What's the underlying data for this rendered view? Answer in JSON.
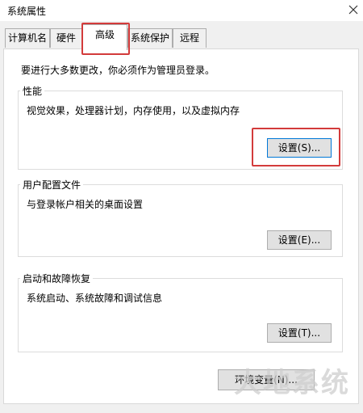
{
  "window": {
    "title": "系统属性",
    "close_icon": "close-icon"
  },
  "tabs": [
    {
      "label": "计算机名",
      "active": false
    },
    {
      "label": "硬件",
      "active": false
    },
    {
      "label": "高级",
      "active": true
    },
    {
      "label": "系统保护",
      "active": false
    },
    {
      "label": "远程",
      "active": false
    }
  ],
  "advanced": {
    "admin_notice": "要进行大多数更改，你必须作为管理员登录。",
    "performance": {
      "label": "性能",
      "description": "视觉效果，处理器计划，内存使用，以及虚拟内存",
      "button": "设置(S)..."
    },
    "user_profiles": {
      "label": "用户配置文件",
      "description": "与登录帐户相关的桌面设置",
      "button": "设置(E)..."
    },
    "startup_recovery": {
      "label": "启动和故障恢复",
      "description": "系统启动、系统故障和调试信息",
      "button": "设置(T)..."
    },
    "env_button": "环境变量(N)..."
  },
  "watermark": "大地系统",
  "colors": {
    "highlight": "#d33b3b",
    "focus": "#0078d7"
  }
}
